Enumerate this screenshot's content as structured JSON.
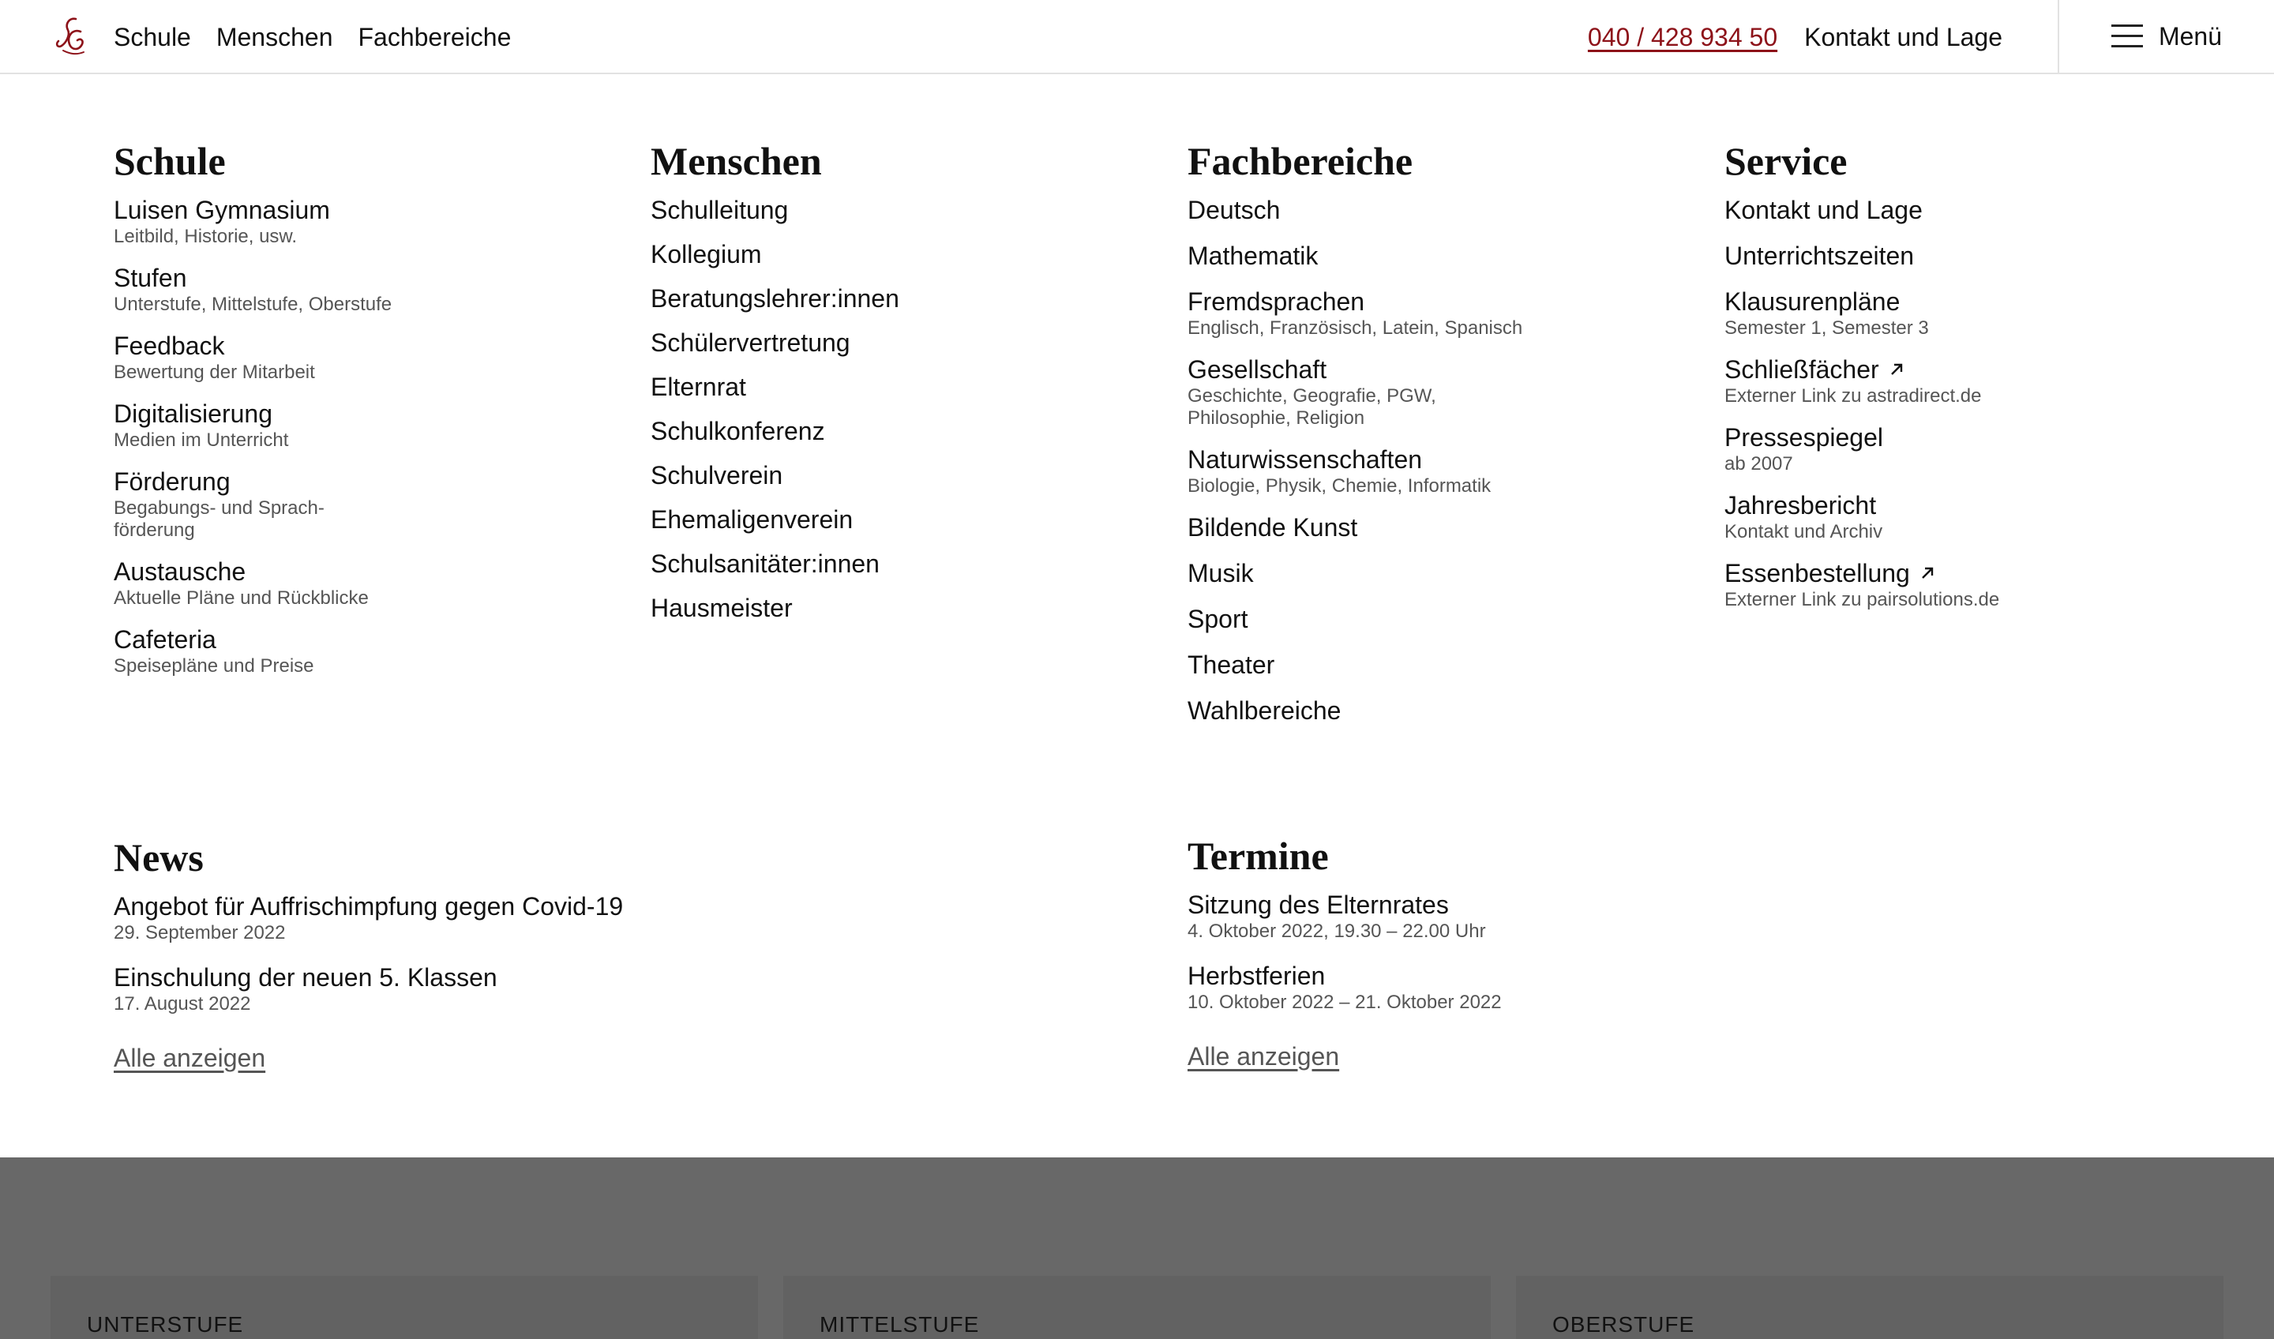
{
  "header": {
    "nav": [
      "Schule",
      "Menschen",
      "Fachbereiche"
    ],
    "phone": "040 / 428 934 50",
    "contact": "Kontakt und Lage",
    "menu_label": "Menü",
    "logo_icon": "lg-monogram-logo",
    "accent_color": "#8d1219"
  },
  "menu": {
    "schule": {
      "heading": "Schule",
      "items": [
        {
          "title": "Luisen Gymnasium",
          "sub": "Leitbild, Historie, usw."
        },
        {
          "title": "Stufen",
          "sub": "Unterstufe, Mittelstufe, Oberstufe"
        },
        {
          "title": "Feedback",
          "sub": "Bewertung der Mitarbeit"
        },
        {
          "title": "Digitalisierung",
          "sub": "Medien im Unterricht"
        },
        {
          "title": "Förderung",
          "sub": "Begabungs- und Sprach-\nförderung"
        },
        {
          "title": "Austausche",
          "sub": "Aktuelle Pläne und Rückblicke"
        },
        {
          "title": "Cafeteria",
          "sub": "Speisepläne und Preise"
        }
      ]
    },
    "menschen": {
      "heading": "Menschen",
      "items": [
        "Schulleitung",
        "Kollegium",
        "Beratungslehrer:innen",
        "Schülervertretung",
        "Elternrat",
        "Schulkonferenz",
        "Schulverein",
        "Ehemaligenverein",
        "Schulsanitäter:innen",
        "Hausmeister"
      ]
    },
    "fachbereiche": {
      "heading": "Fachbereiche",
      "items": [
        {
          "title": "Deutsch",
          "sub": ""
        },
        {
          "title": "Mathematik",
          "sub": ""
        },
        {
          "title": "Fremdsprachen",
          "sub": "Englisch, Französisch, Latein, Spanisch"
        },
        {
          "title": "Gesellschaft",
          "sub": "Geschichte, Geografie, PGW,\nPhilosophie, Religion"
        },
        {
          "title": "Naturwissenschaften",
          "sub": "Biologie, Physik, Chemie, Informatik"
        },
        {
          "title": "Bildende Kunst",
          "sub": ""
        },
        {
          "title": "Musik",
          "sub": ""
        },
        {
          "title": "Sport",
          "sub": ""
        },
        {
          "title": "Theater",
          "sub": ""
        },
        {
          "title": "Wahlbereiche",
          "sub": ""
        }
      ]
    },
    "service": {
      "heading": "Service",
      "items": [
        {
          "title": "Kontakt und Lage",
          "sub": "",
          "external": false
        },
        {
          "title": "Unterrichtszeiten",
          "sub": "",
          "external": false
        },
        {
          "title": "Klausurenpläne",
          "sub": "Semester 1, Semester 3",
          "external": false
        },
        {
          "title": "Schließfächer",
          "sub": "Externer Link zu astradirect.de",
          "external": true
        },
        {
          "title": "Pressespiegel",
          "sub": "ab 2007",
          "external": false
        },
        {
          "title": "Jahresbericht",
          "sub": "Kontakt und Archiv",
          "external": false
        },
        {
          "title": "Essenbestellung",
          "sub": "Externer Link zu pairsolutions.de",
          "external": true
        }
      ]
    }
  },
  "news": {
    "heading": "News",
    "items": [
      {
        "title": "Angebot für Auffrischimpfung gegen Covid-19",
        "date": "29. September 2022"
      },
      {
        "title": "Einschulung der neuen 5. Klassen",
        "date": "17. August 2022"
      }
    ],
    "show_all": "Alle anzeigen"
  },
  "termine": {
    "heading": "Termine",
    "items": [
      {
        "title": "Sitzung des Elternrates",
        "date": "4. Oktober 2022, 19.30 – 22.00 Uhr"
      },
      {
        "title": "Herbstferien",
        "date": "10. Oktober 2022 – 21. Oktober 2022"
      }
    ],
    "show_all": "Alle anzeigen"
  },
  "background_cards": [
    "UNTERSTUFE",
    "MITTELSTUFE",
    "OBERSTUFE"
  ]
}
